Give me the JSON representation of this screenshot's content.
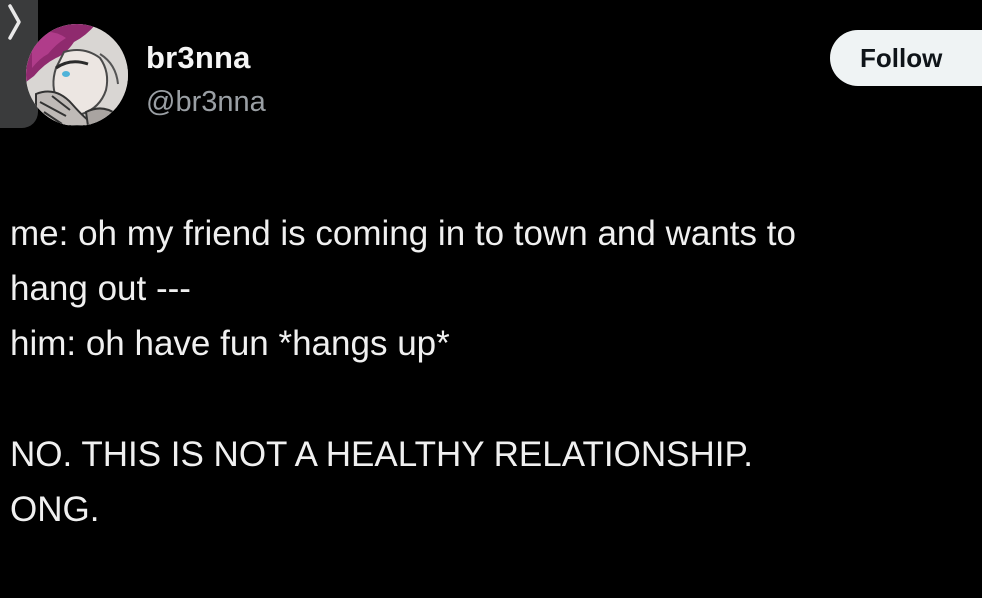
{
  "tweet": {
    "author": {
      "display_name": "br3nna",
      "handle": "@br3nna",
      "avatar_icon": "anime-character-avatar"
    },
    "follow_button_label": "Follow",
    "body_lines": [
      "me: oh my friend is coming in to town and wants to",
      "hang out ---",
      "him: oh have fun *hangs up*",
      "",
      "NO. THIS IS NOT A HEALTHY RELATIONSHIP.",
      "ONG."
    ]
  },
  "ui": {
    "back_tab_icon": "chevron-right-icon",
    "colors": {
      "background": "#000000",
      "text_primary": "#e7e9ea",
      "text_secondary": "#9a9fa4",
      "follow_bg": "#eff3f4",
      "follow_text": "#0f1419",
      "side_tab": "#3a3b3c"
    }
  }
}
